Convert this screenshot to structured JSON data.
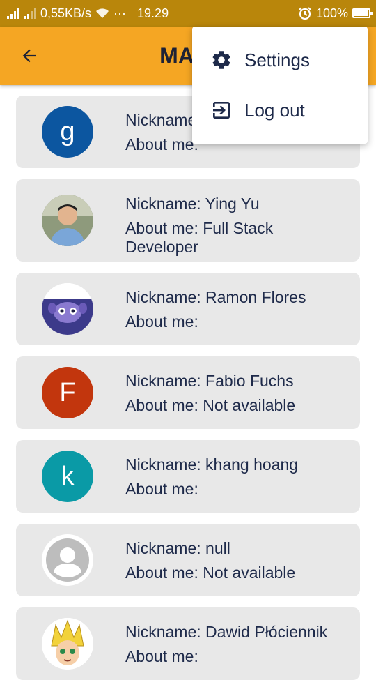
{
  "status_bar": {
    "speed": "0,55KB/s",
    "dots": "···",
    "time": "19.29",
    "battery": "100%",
    "battery_level": 1.0
  },
  "app_bar": {
    "title": "MAIN",
    "back_icon": "arrow-back-icon"
  },
  "menu": {
    "items": [
      {
        "label": "Settings",
        "icon": "gear-icon"
      },
      {
        "label": "Log out",
        "icon": "logout-icon"
      }
    ]
  },
  "users": [
    {
      "nickname": "Nickname: g",
      "about": "About me:",
      "avatar": {
        "type": "letter",
        "letter": "g",
        "color": "#0c56a0"
      }
    },
    {
      "nickname": "Nickname: Ying Yu",
      "about": "About me: Full Stack Developer",
      "avatar": {
        "type": "photo-person"
      }
    },
    {
      "nickname": "Nickname: Ramon Flores",
      "about": "About me:",
      "avatar": {
        "type": "photo-creature"
      }
    },
    {
      "nickname": "Nickname: Fabio Fuchs",
      "about": "About me: Not available",
      "avatar": {
        "type": "letter",
        "letter": "F",
        "color": "#c2360d"
      }
    },
    {
      "nickname": "Nickname: khang hoang",
      "about": "About me:",
      "avatar": {
        "type": "letter",
        "letter": "k",
        "color": "#0a9aa6"
      }
    },
    {
      "nickname": "Nickname: null",
      "about": "About me: Not available",
      "avatar": {
        "type": "default-person"
      }
    },
    {
      "nickname": "Nickname: Dawid Płóciennik",
      "about": "About me:",
      "avatar": {
        "type": "photo-anime"
      }
    }
  ]
}
